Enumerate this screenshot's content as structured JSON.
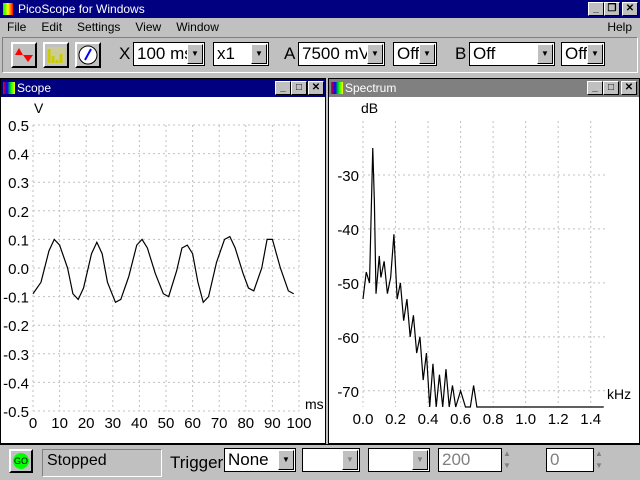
{
  "app": {
    "title": "PicoScope for Windows"
  },
  "menu": [
    "File",
    "Edit",
    "Settings",
    "View",
    "Window",
    "Help"
  ],
  "toolbar": {
    "scope_icon": "scope-waveform-icon",
    "spectrum_icon": "spectrum-bars-icon",
    "meter_icon": "meter-dial-icon",
    "x_label": "X",
    "timebase": "100 ms",
    "multiplier": "x1",
    "a_label": "A",
    "a_range": "7500 mV",
    "a_coupling": "Off",
    "b_label": "B",
    "b_range": "Off",
    "b_coupling": "Off"
  },
  "scope": {
    "title": "Scope",
    "y_unit": "V",
    "x_unit": "ms"
  },
  "spectrum": {
    "title": "Spectrum",
    "y_unit": "dB",
    "x_unit": "kHz"
  },
  "status": {
    "go": "GO",
    "state": "Stopped",
    "trigger_label": "Trigger",
    "trigger_mode": "None",
    "trigger_level": "200",
    "delay": "0"
  },
  "colors": {
    "titlebar_active": "#000080",
    "titlebar_inactive": "#808080",
    "go": "#00ff00"
  },
  "chart_data": [
    {
      "type": "line",
      "title": "Scope",
      "ylabel": "V",
      "xlabel": "ms",
      "xlim": [
        0,
        100
      ],
      "ylim": [
        -0.5,
        0.5
      ],
      "grid": true,
      "xticks": [
        "0",
        "10",
        "20",
        "30",
        "40",
        "50",
        "60",
        "70",
        "80",
        "90",
        "100"
      ],
      "yticks": [
        "0.5",
        "0.4",
        "0.3",
        "0.2",
        "0.1",
        "0.0",
        "-0.1",
        "-0.2",
        "-0.3",
        "-0.4",
        "-0.5"
      ],
      "x": [
        0,
        3,
        6,
        8,
        10,
        13,
        15,
        17,
        19,
        22,
        24,
        26,
        28,
        31,
        33,
        36,
        39,
        41,
        43,
        46,
        49,
        51,
        54,
        56,
        58,
        60,
        62,
        64,
        66,
        69,
        72,
        74,
        76,
        79,
        81,
        83,
        86,
        88,
        90,
        93,
        96,
        98
      ],
      "y": [
        -0.09,
        -0.05,
        0.06,
        0.1,
        0.08,
        0,
        -0.09,
        -0.11,
        -0.07,
        0.05,
        0.09,
        0.05,
        -0.05,
        -0.12,
        -0.11,
        -0.03,
        0.08,
        0.1,
        0.07,
        -0.02,
        -0.09,
        -0.1,
        -0.01,
        0.07,
        0.08,
        0.05,
        -0.05,
        -0.12,
        -0.1,
        0.02,
        0.1,
        0.11,
        0.07,
        -0.02,
        -0.07,
        -0.08,
        0,
        0.1,
        0.1,
        0,
        -0.08,
        -0.09
      ]
    },
    {
      "type": "line",
      "title": "Spectrum",
      "ylabel": "dB",
      "xlabel": "kHz",
      "xlim": [
        0,
        1.5
      ],
      "ylim": [
        -73,
        -20
      ],
      "grid": true,
      "xticks": [
        "0.0",
        "0.2",
        "0.4",
        "0.6",
        "0.8",
        "1.0",
        "1.2",
        "1.4"
      ],
      "yticks": [
        "-30",
        "-40",
        "-50",
        "-60",
        "-70"
      ],
      "x": [
        0,
        0.02,
        0.04,
        0.06,
        0.07,
        0.08,
        0.1,
        0.11,
        0.13,
        0.15,
        0.17,
        0.19,
        0.21,
        0.23,
        0.25,
        0.27,
        0.29,
        0.31,
        0.33,
        0.35,
        0.37,
        0.39,
        0.41,
        0.43,
        0.45,
        0.47,
        0.49,
        0.51,
        0.53,
        0.55,
        0.57,
        0.6,
        0.63,
        0.66,
        0.68,
        0.7,
        1.48
      ],
      "y": [
        -53,
        -48,
        -50,
        -25,
        -35,
        -52,
        -45,
        -49,
        -46,
        -52,
        -49,
        -41,
        -53,
        -50,
        -57,
        -53,
        -60,
        -56,
        -63,
        -60,
        -68,
        -63,
        -73,
        -65,
        -73,
        -67,
        -73,
        -66,
        -73,
        -69,
        -73,
        -70,
        -73,
        -73,
        -69,
        -73,
        -73
      ]
    }
  ]
}
